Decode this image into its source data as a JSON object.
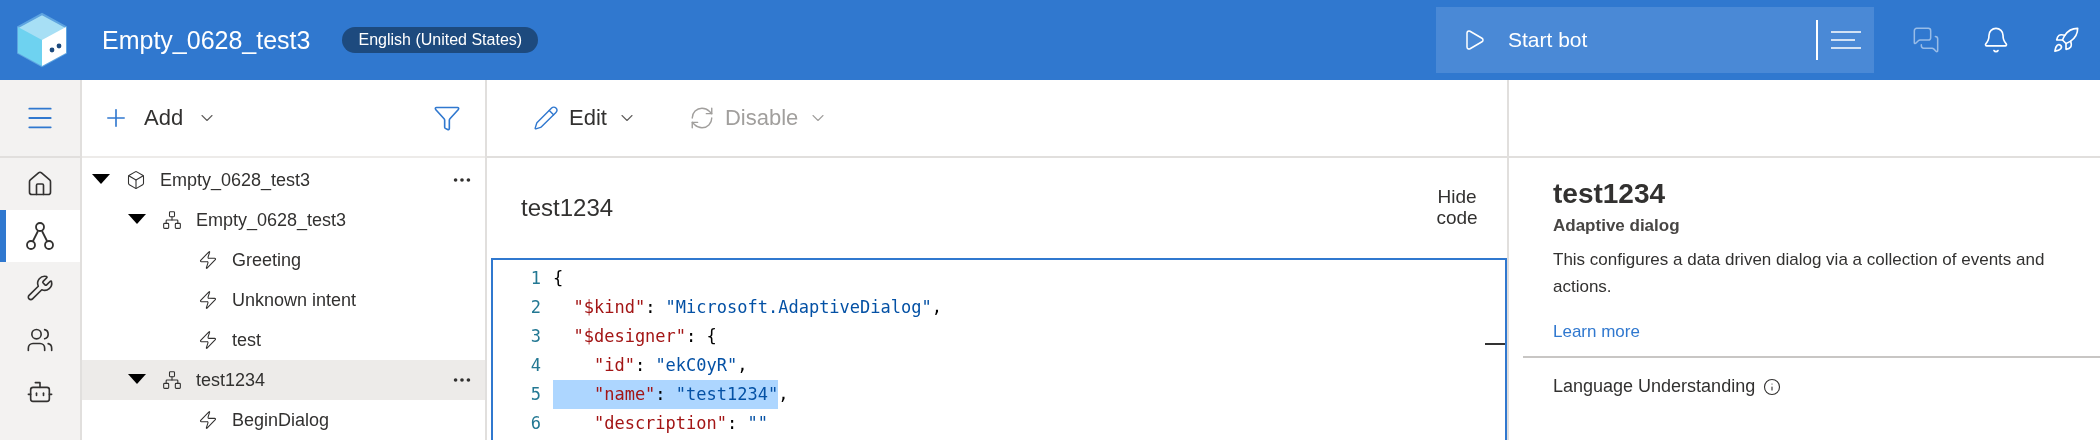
{
  "header": {
    "title": "Empty_0628_test3",
    "locale_badge": "English (United States)",
    "start_button": {
      "label": "Start bot"
    }
  },
  "nav_rail": {
    "items": [
      {
        "kind": "home",
        "selected": false
      },
      {
        "kind": "dialogs",
        "selected": true
      },
      {
        "kind": "tools",
        "selected": false
      },
      {
        "kind": "users",
        "selected": false
      },
      {
        "kind": "bot",
        "selected": false
      }
    ]
  },
  "tree_toolbar": {
    "add_label": "Add"
  },
  "tree": [
    {
      "label": "Empty_0628_test3",
      "kind": "bot",
      "expanded": true,
      "selected": false,
      "show_menu": true,
      "children": [
        {
          "label": "Empty_0628_test3",
          "kind": "dialog",
          "expanded": true,
          "selected": false,
          "show_menu": false,
          "children": [
            {
              "label": "Greeting",
              "kind": "trigger",
              "selected": false,
              "show_menu": false
            },
            {
              "label": "Unknown intent",
              "kind": "trigger",
              "selected": false,
              "show_menu": false
            },
            {
              "label": "test",
              "kind": "trigger",
              "selected": false,
              "show_menu": false
            }
          ]
        },
        {
          "label": "test1234",
          "kind": "dialog",
          "expanded": true,
          "selected": true,
          "show_menu": true,
          "children": [
            {
              "label": "BeginDialog",
              "kind": "trigger",
              "selected": false,
              "show_menu": false
            }
          ]
        }
      ]
    }
  ],
  "toolbar": [
    {
      "label": "Edit",
      "kind": "edit",
      "disabled": false
    },
    {
      "label": "Disable",
      "kind": "disable",
      "disabled": true
    }
  ],
  "editor": {
    "title": "test1234",
    "hide_code_label": "Hide code",
    "lines": [
      {
        "number": "1",
        "tokens": [
          {
            "kind": "punct",
            "text": "{",
            "selected": false
          }
        ]
      },
      {
        "number": "2",
        "tokens": [
          {
            "kind": "key",
            "text": "  \"$kind\"",
            "selected": false
          },
          {
            "kind": "punct",
            "text": ": ",
            "selected": false
          },
          {
            "kind": "string",
            "text": "\"Microsoft.AdaptiveDialog\"",
            "selected": false
          },
          {
            "kind": "punct",
            "text": ",",
            "selected": false
          }
        ]
      },
      {
        "number": "3",
        "tokens": [
          {
            "kind": "key",
            "text": "  \"$designer\"",
            "selected": false
          },
          {
            "kind": "punct",
            "text": ": {",
            "selected": false
          }
        ]
      },
      {
        "number": "4",
        "tokens": [
          {
            "kind": "key",
            "text": "    \"id\"",
            "selected": false
          },
          {
            "kind": "punct",
            "text": ": ",
            "selected": false
          },
          {
            "kind": "string",
            "text": "\"ekC0yR\"",
            "selected": false
          },
          {
            "kind": "punct",
            "text": ",",
            "selected": false
          }
        ]
      },
      {
        "number": "5",
        "tokens": [
          {
            "kind": "key",
            "text": "    \"name\"",
            "selected": true
          },
          {
            "kind": "punct",
            "text": ": ",
            "selected": true
          },
          {
            "kind": "string",
            "text": "\"test1234\"",
            "selected": true
          },
          {
            "kind": "punct",
            "text": ",",
            "selected": false
          }
        ]
      },
      {
        "number": "6",
        "tokens": [
          {
            "kind": "key",
            "text": "    \"description\"",
            "selected": false
          },
          {
            "kind": "punct",
            "text": ": ",
            "selected": false
          },
          {
            "kind": "string",
            "text": "\"\"",
            "selected": false
          }
        ]
      }
    ]
  },
  "properties": {
    "title": "test1234",
    "subtitle": "Adaptive dialog",
    "description": "This configures a data driven dialog via a collection of events and actions.",
    "link": "Learn more",
    "section_title": "Language Understanding"
  }
}
